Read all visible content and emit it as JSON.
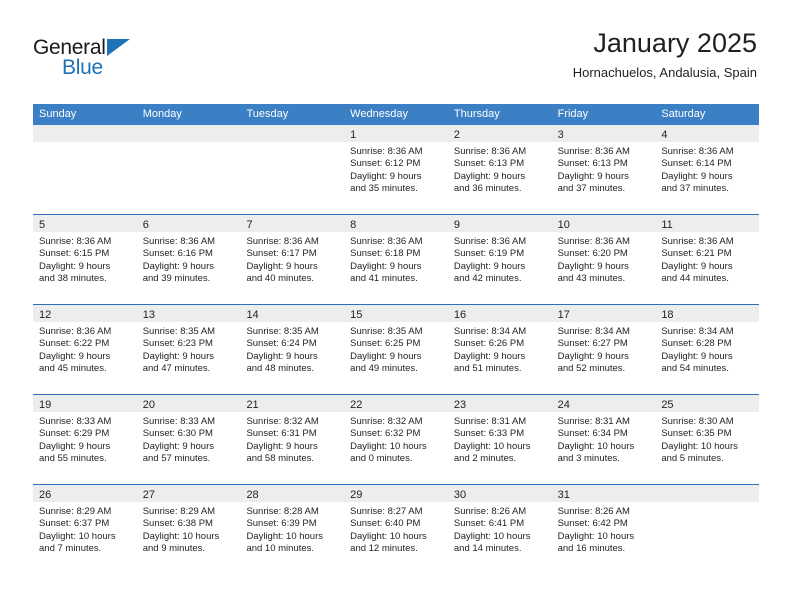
{
  "brand": {
    "name_top": "General",
    "name_bottom": "Blue",
    "accent_color": "#1e72b8"
  },
  "header": {
    "title": "January 2025",
    "subtitle": "Hornachuelos, Andalusia, Spain"
  },
  "calendar": {
    "header_bg": "#3b7fc4",
    "row_border_color": "#2f6fb5",
    "day_band_bg": "#eceded",
    "weekdays": [
      "Sunday",
      "Monday",
      "Tuesday",
      "Wednesday",
      "Thursday",
      "Friday",
      "Saturday"
    ],
    "weeks": [
      [
        {
          "day": "",
          "lines": []
        },
        {
          "day": "",
          "lines": []
        },
        {
          "day": "",
          "lines": []
        },
        {
          "day": "1",
          "lines": [
            "Sunrise: 8:36 AM",
            "Sunset: 6:12 PM",
            "Daylight: 9 hours",
            "and 35 minutes."
          ]
        },
        {
          "day": "2",
          "lines": [
            "Sunrise: 8:36 AM",
            "Sunset: 6:13 PM",
            "Daylight: 9 hours",
            "and 36 minutes."
          ]
        },
        {
          "day": "3",
          "lines": [
            "Sunrise: 8:36 AM",
            "Sunset: 6:13 PM",
            "Daylight: 9 hours",
            "and 37 minutes."
          ]
        },
        {
          "day": "4",
          "lines": [
            "Sunrise: 8:36 AM",
            "Sunset: 6:14 PM",
            "Daylight: 9 hours",
            "and 37 minutes."
          ]
        }
      ],
      [
        {
          "day": "5",
          "lines": [
            "Sunrise: 8:36 AM",
            "Sunset: 6:15 PM",
            "Daylight: 9 hours",
            "and 38 minutes."
          ]
        },
        {
          "day": "6",
          "lines": [
            "Sunrise: 8:36 AM",
            "Sunset: 6:16 PM",
            "Daylight: 9 hours",
            "and 39 minutes."
          ]
        },
        {
          "day": "7",
          "lines": [
            "Sunrise: 8:36 AM",
            "Sunset: 6:17 PM",
            "Daylight: 9 hours",
            "and 40 minutes."
          ]
        },
        {
          "day": "8",
          "lines": [
            "Sunrise: 8:36 AM",
            "Sunset: 6:18 PM",
            "Daylight: 9 hours",
            "and 41 minutes."
          ]
        },
        {
          "day": "9",
          "lines": [
            "Sunrise: 8:36 AM",
            "Sunset: 6:19 PM",
            "Daylight: 9 hours",
            "and 42 minutes."
          ]
        },
        {
          "day": "10",
          "lines": [
            "Sunrise: 8:36 AM",
            "Sunset: 6:20 PM",
            "Daylight: 9 hours",
            "and 43 minutes."
          ]
        },
        {
          "day": "11",
          "lines": [
            "Sunrise: 8:36 AM",
            "Sunset: 6:21 PM",
            "Daylight: 9 hours",
            "and 44 minutes."
          ]
        }
      ],
      [
        {
          "day": "12",
          "lines": [
            "Sunrise: 8:36 AM",
            "Sunset: 6:22 PM",
            "Daylight: 9 hours",
            "and 45 minutes."
          ]
        },
        {
          "day": "13",
          "lines": [
            "Sunrise: 8:35 AM",
            "Sunset: 6:23 PM",
            "Daylight: 9 hours",
            "and 47 minutes."
          ]
        },
        {
          "day": "14",
          "lines": [
            "Sunrise: 8:35 AM",
            "Sunset: 6:24 PM",
            "Daylight: 9 hours",
            "and 48 minutes."
          ]
        },
        {
          "day": "15",
          "lines": [
            "Sunrise: 8:35 AM",
            "Sunset: 6:25 PM",
            "Daylight: 9 hours",
            "and 49 minutes."
          ]
        },
        {
          "day": "16",
          "lines": [
            "Sunrise: 8:34 AM",
            "Sunset: 6:26 PM",
            "Daylight: 9 hours",
            "and 51 minutes."
          ]
        },
        {
          "day": "17",
          "lines": [
            "Sunrise: 8:34 AM",
            "Sunset: 6:27 PM",
            "Daylight: 9 hours",
            "and 52 minutes."
          ]
        },
        {
          "day": "18",
          "lines": [
            "Sunrise: 8:34 AM",
            "Sunset: 6:28 PM",
            "Daylight: 9 hours",
            "and 54 minutes."
          ]
        }
      ],
      [
        {
          "day": "19",
          "lines": [
            "Sunrise: 8:33 AM",
            "Sunset: 6:29 PM",
            "Daylight: 9 hours",
            "and 55 minutes."
          ]
        },
        {
          "day": "20",
          "lines": [
            "Sunrise: 8:33 AM",
            "Sunset: 6:30 PM",
            "Daylight: 9 hours",
            "and 57 minutes."
          ]
        },
        {
          "day": "21",
          "lines": [
            "Sunrise: 8:32 AM",
            "Sunset: 6:31 PM",
            "Daylight: 9 hours",
            "and 58 minutes."
          ]
        },
        {
          "day": "22",
          "lines": [
            "Sunrise: 8:32 AM",
            "Sunset: 6:32 PM",
            "Daylight: 10 hours",
            "and 0 minutes."
          ]
        },
        {
          "day": "23",
          "lines": [
            "Sunrise: 8:31 AM",
            "Sunset: 6:33 PM",
            "Daylight: 10 hours",
            "and 2 minutes."
          ]
        },
        {
          "day": "24",
          "lines": [
            "Sunrise: 8:31 AM",
            "Sunset: 6:34 PM",
            "Daylight: 10 hours",
            "and 3 minutes."
          ]
        },
        {
          "day": "25",
          "lines": [
            "Sunrise: 8:30 AM",
            "Sunset: 6:35 PM",
            "Daylight: 10 hours",
            "and 5 minutes."
          ]
        }
      ],
      [
        {
          "day": "26",
          "lines": [
            "Sunrise: 8:29 AM",
            "Sunset: 6:37 PM",
            "Daylight: 10 hours",
            "and 7 minutes."
          ]
        },
        {
          "day": "27",
          "lines": [
            "Sunrise: 8:29 AM",
            "Sunset: 6:38 PM",
            "Daylight: 10 hours",
            "and 9 minutes."
          ]
        },
        {
          "day": "28",
          "lines": [
            "Sunrise: 8:28 AM",
            "Sunset: 6:39 PM",
            "Daylight: 10 hours",
            "and 10 minutes."
          ]
        },
        {
          "day": "29",
          "lines": [
            "Sunrise: 8:27 AM",
            "Sunset: 6:40 PM",
            "Daylight: 10 hours",
            "and 12 minutes."
          ]
        },
        {
          "day": "30",
          "lines": [
            "Sunrise: 8:26 AM",
            "Sunset: 6:41 PM",
            "Daylight: 10 hours",
            "and 14 minutes."
          ]
        },
        {
          "day": "31",
          "lines": [
            "Sunrise: 8:26 AM",
            "Sunset: 6:42 PM",
            "Daylight: 10 hours",
            "and 16 minutes."
          ]
        },
        {
          "day": "",
          "lines": []
        }
      ]
    ]
  }
}
